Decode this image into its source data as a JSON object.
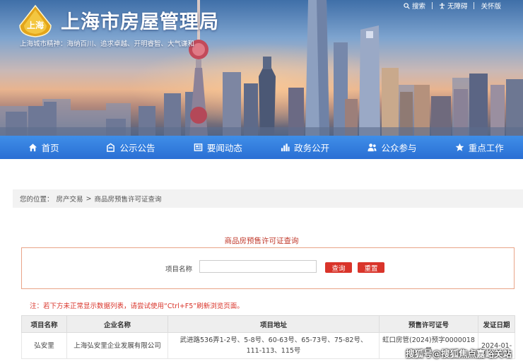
{
  "header": {
    "site_title": "上海市房屋管理局",
    "city_spirit": "上海城市精神：海纳百川、追求卓越、开明睿智、大气谦和",
    "logo_text": "上海",
    "top_links": [
      "搜索",
      "无障碍",
      "关怀版"
    ]
  },
  "nav": {
    "items": [
      {
        "label": "首页",
        "icon": "home-icon"
      },
      {
        "label": "公示公告",
        "icon": "megaphone-icon"
      },
      {
        "label": "要闻动态",
        "icon": "news-icon"
      },
      {
        "label": "政务公开",
        "icon": "bar-chart-icon"
      },
      {
        "label": "公众参与",
        "icon": "users-icon"
      },
      {
        "label": "重点工作",
        "icon": "star-icon"
      }
    ]
  },
  "breadcrumb": {
    "prefix": "您的位置：",
    "items": [
      "房产交易",
      "商品房预售许可证查询"
    ],
    "separator": ">"
  },
  "query": {
    "title": "商品房预售许可证查询",
    "label": "项目名称",
    "input_value": "",
    "search_button": "查询",
    "reset_button": "重置"
  },
  "note": "注：若下方未正常显示数据列表，请尝试使用“Ctrl+F5”刷新浏览页面。",
  "table": {
    "headers": [
      "项目名称",
      "企业名称",
      "项目地址",
      "预售许可证号",
      "发证日期"
    ],
    "rows": [
      {
        "project": "弘安里",
        "company": "上海弘安里企业发展有限公司",
        "address": "武进路536弄1-2号、5-8号、60-63号、65-73号、75-82号、111-113、115号",
        "permit": "虹口房管(2024)预字0000018号",
        "date": "2024-01-"
      }
    ]
  },
  "watermark": "搜狐号@搜狐焦点嘉峪关站",
  "colors": {
    "nav_blue": "#2a6fd4",
    "accent_red": "#d9342a",
    "panel_border": "#e9a488"
  }
}
